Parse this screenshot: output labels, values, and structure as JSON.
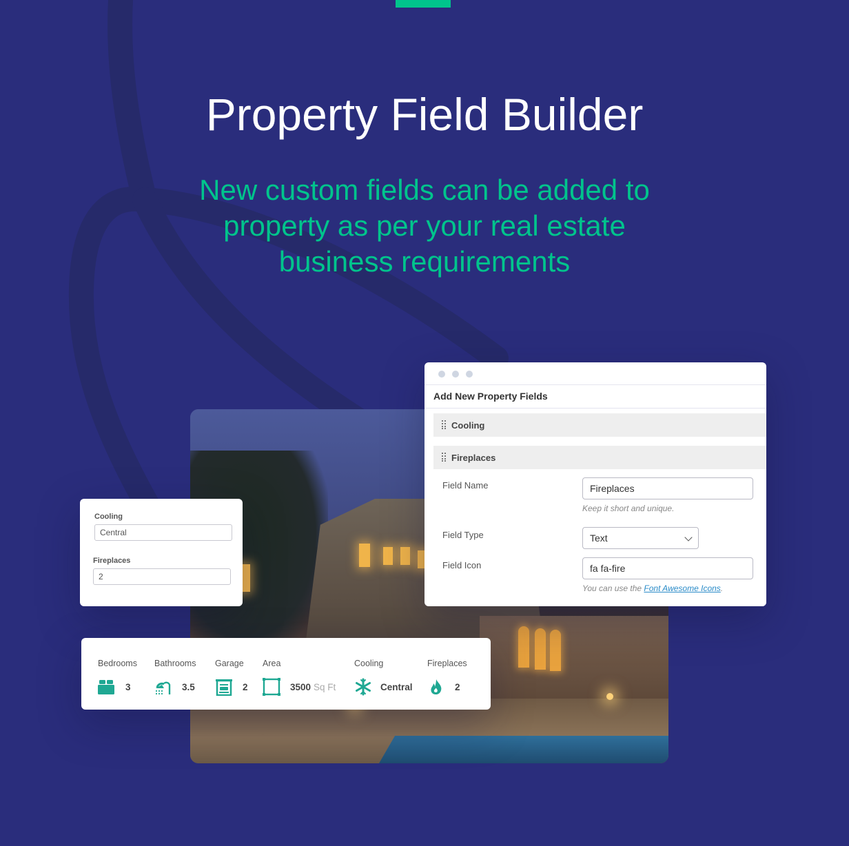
{
  "colors": {
    "background": "#2a2d7c",
    "accent": "#00c48c",
    "icon_teal": "#1fa893",
    "link": "#2a8bc8"
  },
  "hero": {
    "title": "Property Field Builder",
    "subtitle": "New custom fields can be added to property as per your real estate business requirements"
  },
  "admin_panel": {
    "title": "Add New Property Fields",
    "collapsed_fields": [
      {
        "label": "Cooling"
      },
      {
        "label": "Fireplaces"
      }
    ],
    "form": {
      "field_name_label": "Field Name",
      "field_name_value": "Fireplaces",
      "field_name_hint": "Keep it short and unique.",
      "field_type_label": "Field Type",
      "field_type_value": "Text",
      "field_icon_label": "Field Icon",
      "field_icon_value": "fa fa-fire",
      "field_icon_hint_prefix": "You can use the ",
      "field_icon_hint_link": "Font Awesome Icons",
      "field_icon_hint_suffix": "."
    }
  },
  "mini_form": {
    "cooling_label": "Cooling",
    "cooling_value": "Central",
    "fireplaces_label": "Fireplaces",
    "fireplaces_value": "2"
  },
  "features": [
    {
      "label": "Bedrooms",
      "icon": "bed-icon",
      "value": "3"
    },
    {
      "label": "Bathrooms",
      "icon": "shower-icon",
      "value": "3.5"
    },
    {
      "label": "Garage",
      "icon": "garage-icon",
      "value": "2"
    },
    {
      "label": "Area",
      "icon": "area-icon",
      "value": "3500",
      "unit": "Sq Ft"
    },
    {
      "label": "Cooling",
      "icon": "snowflake-icon",
      "value": "Central"
    },
    {
      "label": "Fireplaces",
      "icon": "fire-icon",
      "value": "2"
    }
  ]
}
